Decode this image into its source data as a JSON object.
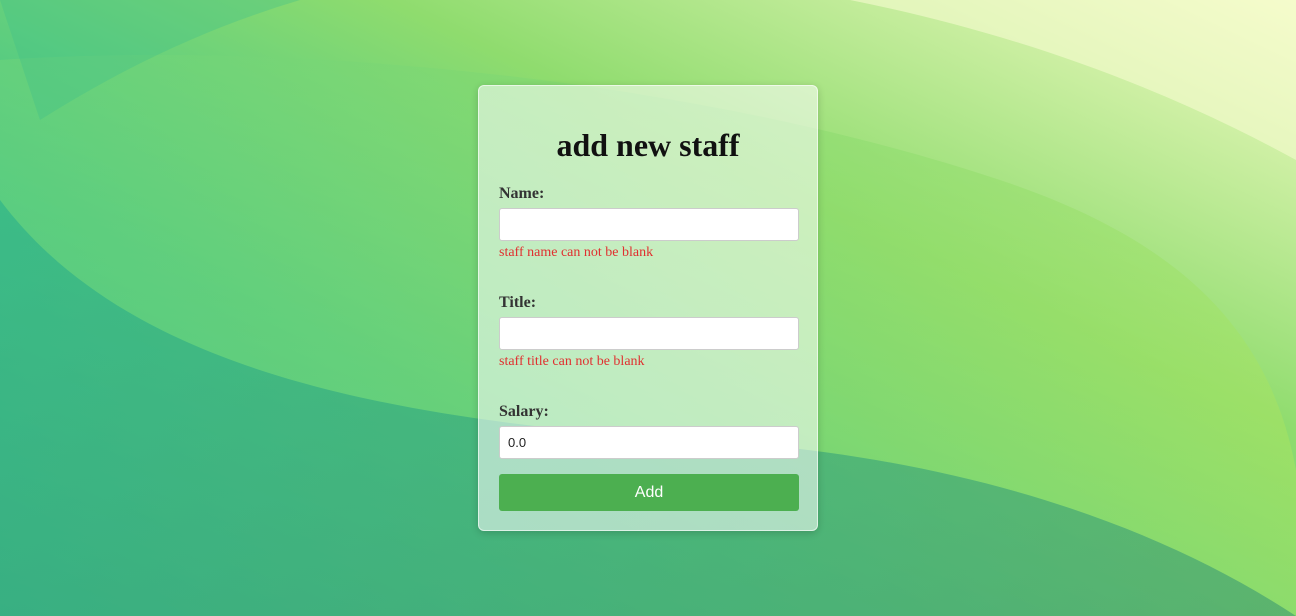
{
  "colors": {
    "button_bg": "#4caf50",
    "error_text": "#e03030",
    "label_text": "#333333"
  },
  "form": {
    "title": "add new staff",
    "name": {
      "label": "Name:",
      "value": "",
      "error": "staff name can not be blank"
    },
    "title_field": {
      "label": "Title:",
      "value": "",
      "error": "staff title can not be blank"
    },
    "salary": {
      "label": "Salary:",
      "value": "0.0"
    },
    "submit_label": "Add"
  }
}
